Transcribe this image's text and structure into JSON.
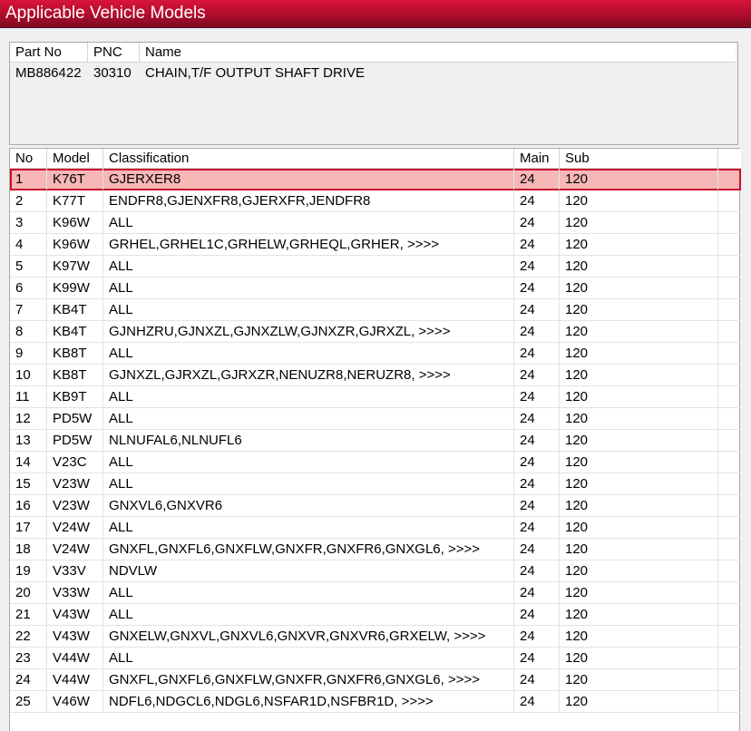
{
  "window": {
    "title": "Applicable Vehicle Models"
  },
  "part": {
    "columns": [
      "Part No",
      "PNC",
      "Name"
    ],
    "row": {
      "part_no": "MB886422",
      "pnc": "30310",
      "name": "CHAIN,T/F OUTPUT SHAFT DRIVE"
    }
  },
  "vehicles": {
    "columns": [
      "No",
      "Model",
      "Classification",
      "Main",
      "Sub"
    ],
    "selected_row": 1,
    "rows": [
      {
        "no": "1",
        "model": "K76T",
        "classification": "GJERXER8",
        "main": "24",
        "sub": "120"
      },
      {
        "no": "2",
        "model": "K77T",
        "classification": "ENDFR8,GJENXFR8,GJERXFR,JENDFR8",
        "main": "24",
        "sub": "120"
      },
      {
        "no": "3",
        "model": "K96W",
        "classification": "ALL",
        "main": "24",
        "sub": "120"
      },
      {
        "no": "4",
        "model": "K96W",
        "classification": "GRHEL,GRHEL1C,GRHELW,GRHEQL,GRHER,  >>>>",
        "main": "24",
        "sub": "120"
      },
      {
        "no": "5",
        "model": "K97W",
        "classification": "ALL",
        "main": "24",
        "sub": "120"
      },
      {
        "no": "6",
        "model": "K99W",
        "classification": "ALL",
        "main": "24",
        "sub": "120"
      },
      {
        "no": "7",
        "model": "KB4T",
        "classification": "ALL",
        "main": "24",
        "sub": "120"
      },
      {
        "no": "8",
        "model": "KB4T",
        "classification": "GJNHZRU,GJNXZL,GJNXZLW,GJNXZR,GJRXZL,  >>>>",
        "main": "24",
        "sub": "120"
      },
      {
        "no": "9",
        "model": "KB8T",
        "classification": "ALL",
        "main": "24",
        "sub": "120"
      },
      {
        "no": "10",
        "model": "KB8T",
        "classification": "GJNXZL,GJRXZL,GJRXZR,NENUZR8,NERUZR8,  >>>>",
        "main": "24",
        "sub": "120"
      },
      {
        "no": "11",
        "model": "KB9T",
        "classification": "ALL",
        "main": "24",
        "sub": "120"
      },
      {
        "no": "12",
        "model": "PD5W",
        "classification": "ALL",
        "main": "24",
        "sub": "120"
      },
      {
        "no": "13",
        "model": "PD5W",
        "classification": "NLNUFAL6,NLNUFL6",
        "main": "24",
        "sub": "120"
      },
      {
        "no": "14",
        "model": "V23C",
        "classification": "ALL",
        "main": "24",
        "sub": "120"
      },
      {
        "no": "15",
        "model": "V23W",
        "classification": "ALL",
        "main": "24",
        "sub": "120"
      },
      {
        "no": "16",
        "model": "V23W",
        "classification": "GNXVL6,GNXVR6",
        "main": "24",
        "sub": "120"
      },
      {
        "no": "17",
        "model": "V24W",
        "classification": "ALL",
        "main": "24",
        "sub": "120"
      },
      {
        "no": "18",
        "model": "V24W",
        "classification": "GNXFL,GNXFL6,GNXFLW,GNXFR,GNXFR6,GNXGL6,  >>>>",
        "main": "24",
        "sub": "120"
      },
      {
        "no": "19",
        "model": "V33V",
        "classification": "NDVLW",
        "main": "24",
        "sub": "120"
      },
      {
        "no": "20",
        "model": "V33W",
        "classification": "ALL",
        "main": "24",
        "sub": "120"
      },
      {
        "no": "21",
        "model": "V43W",
        "classification": "ALL",
        "main": "24",
        "sub": "120"
      },
      {
        "no": "22",
        "model": "V43W",
        "classification": "GNXELW,GNXVL,GNXVL6,GNXVR,GNXVR6,GRXELW,  >>>>",
        "main": "24",
        "sub": "120"
      },
      {
        "no": "23",
        "model": "V44W",
        "classification": "ALL",
        "main": "24",
        "sub": "120"
      },
      {
        "no": "24",
        "model": "V44W",
        "classification": "GNXFL,GNXFL6,GNXFLW,GNXFR,GNXFR6,GNXGL6,  >>>>",
        "main": "24",
        "sub": "120"
      },
      {
        "no": "25",
        "model": "V46W",
        "classification": "NDFL6,NDGCL6,NDGL6,NSFAR1D,NSFBR1D,  >>>>",
        "main": "24",
        "sub": "120"
      }
    ]
  },
  "colors": {
    "title_bar": "#c8102e",
    "selected_row_fill": "#f7b7b7",
    "selected_row_border": "#c8102e"
  }
}
